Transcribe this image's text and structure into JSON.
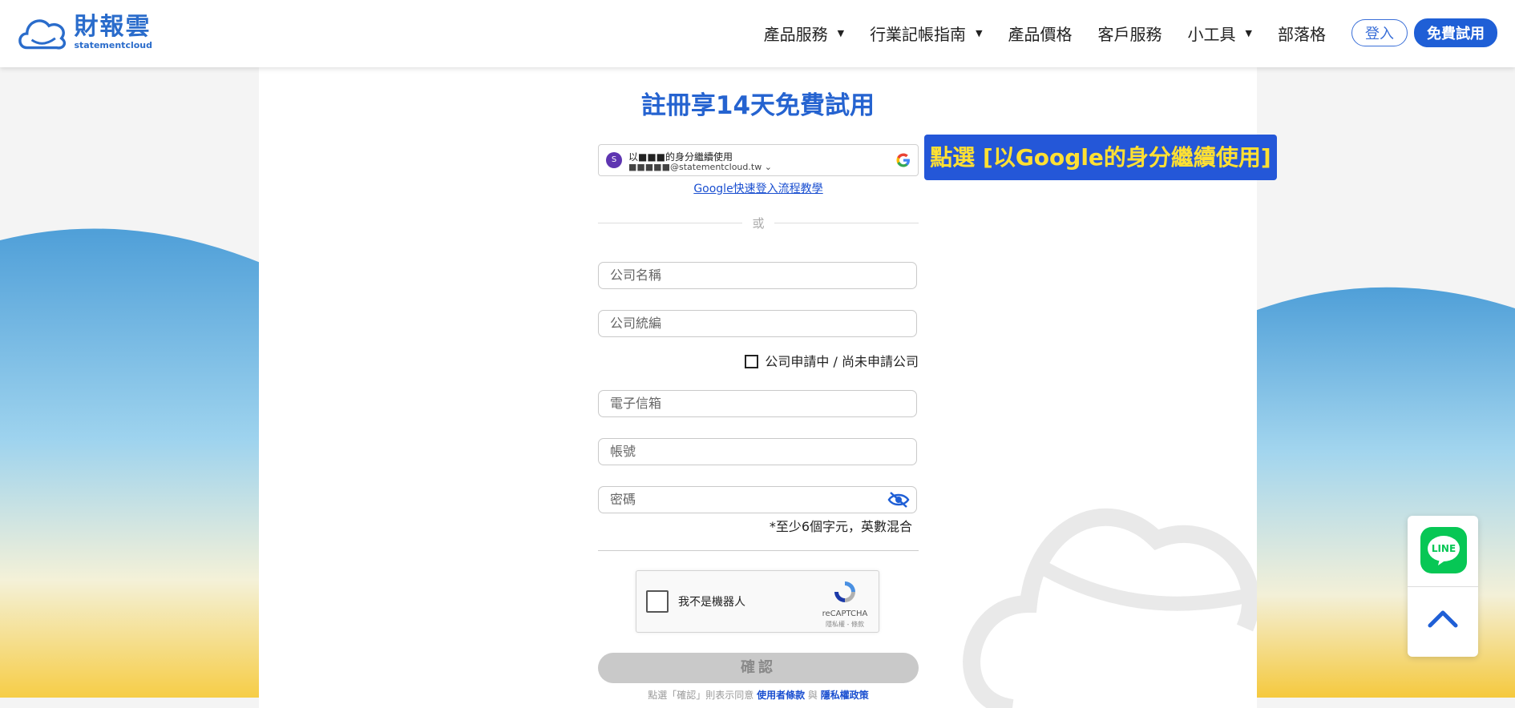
{
  "header": {
    "logo_title": "財報雲",
    "logo_sub": "statementcloud",
    "nav": [
      {
        "label": "產品服務",
        "has_caret": true
      },
      {
        "label": "行業記帳指南",
        "has_caret": true
      },
      {
        "label": "產品價格",
        "has_caret": false
      },
      {
        "label": "客戶服務",
        "has_caret": false
      },
      {
        "label": "小工具",
        "has_caret": true
      },
      {
        "label": "部落格",
        "has_caret": false
      }
    ],
    "login_label": "登入",
    "trial_label": "免費試用"
  },
  "form": {
    "title": "註冊享14天免費試用",
    "google": {
      "avatar_initial": "S",
      "line1": "以■■■的身分繼續使用",
      "line2": "■■■■■@statementcloud.tw",
      "help_link": "Google快速登入流程教學"
    },
    "or_text": "或",
    "company_name_placeholder": "公司名稱",
    "company_id_placeholder": "公司統編",
    "checkbox_label": "公司申請中 / 尚未申請公司",
    "email_placeholder": "電子信箱",
    "account_placeholder": "帳號",
    "password_placeholder": "密碼",
    "password_hint": "*至少6個字元，英數混合",
    "recaptcha": {
      "label": "我不是機器人",
      "brand": "reCAPTCHA",
      "terms": "隱私權 - 條款"
    },
    "submit_label": "確認",
    "terms_prefix": "點選「確認」則表示同意",
    "terms_link1": "使用者條款",
    "terms_and": "與",
    "terms_link2": "隱私權政策"
  },
  "annotation": {
    "text": "點選 [以Google的身分繼續使用]"
  },
  "floating": {
    "line_label": "LINE"
  },
  "colors": {
    "brand_blue": "#2563d0",
    "callout_bg": "#2457d8",
    "callout_text": "#ffe033",
    "line_green": "#07c755"
  }
}
